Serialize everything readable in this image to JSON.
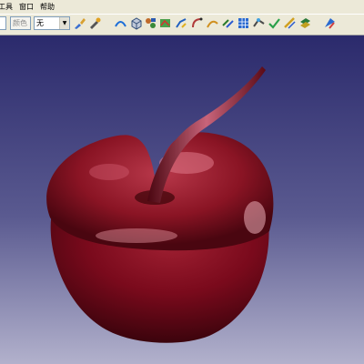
{
  "menubar": {
    "items": [
      {
        "label": "工具"
      },
      {
        "label": "窗口"
      },
      {
        "label": "帮助"
      }
    ]
  },
  "toolbar": {
    "layer_combo": {
      "value": "",
      "state": "disabled"
    },
    "linetype_combo": {
      "value": "颜色"
    },
    "thickness_combo": {
      "value": "无"
    },
    "tools": [
      "paint-brush-icon",
      "pick-color-icon",
      "surface-arc-icon",
      "cube-view-icon",
      "multi-view-icon",
      "boundary-icon",
      "fillet-icon",
      "join-curve-icon",
      "trim-icon",
      "offset-icon",
      "grid-view-icon",
      "extrude-icon",
      "check-icon",
      "sweep-icon",
      "loft-icon",
      "render-sphere-icon"
    ]
  },
  "viewport": {
    "background_top": "#2b2a6c",
    "background_bottom": "#a7a6c6",
    "object": "apple-model",
    "object_color": "#7a0a1c"
  }
}
